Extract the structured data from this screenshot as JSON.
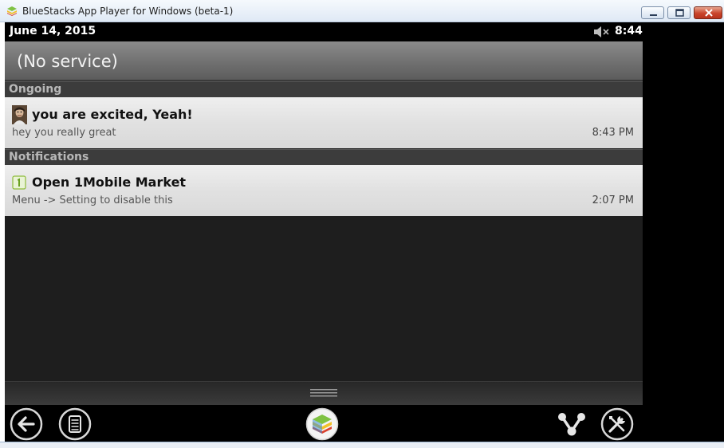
{
  "window": {
    "title": "BlueStacks App Player for Windows (beta-1)",
    "colors": {
      "close": "#c9442b",
      "titlebar": "#dfe9f5"
    }
  },
  "statusbar": {
    "date": "June 14, 2015",
    "time": "8:44",
    "icons": [
      "volume-muted-icon"
    ]
  },
  "carrier": {
    "text": "(No service)"
  },
  "sections": {
    "ongoing": "Ongoing",
    "notifications": "Notifications"
  },
  "ongoing_items": [
    {
      "icon": "person-avatar-icon",
      "title": "you are excited, Yeah!",
      "text": "hey you really great",
      "time": "8:43 PM"
    }
  ],
  "notification_items": [
    {
      "icon": "1mobile-market-icon",
      "title": "Open 1Mobile Market",
      "text": "Menu -> Setting to disable this",
      "time": "2:07 PM"
    }
  ],
  "navbar": {
    "icons": [
      "back-icon",
      "menu-icon",
      "bluestacks-home-icon",
      "share-icon",
      "settings-tools-icon"
    ]
  }
}
